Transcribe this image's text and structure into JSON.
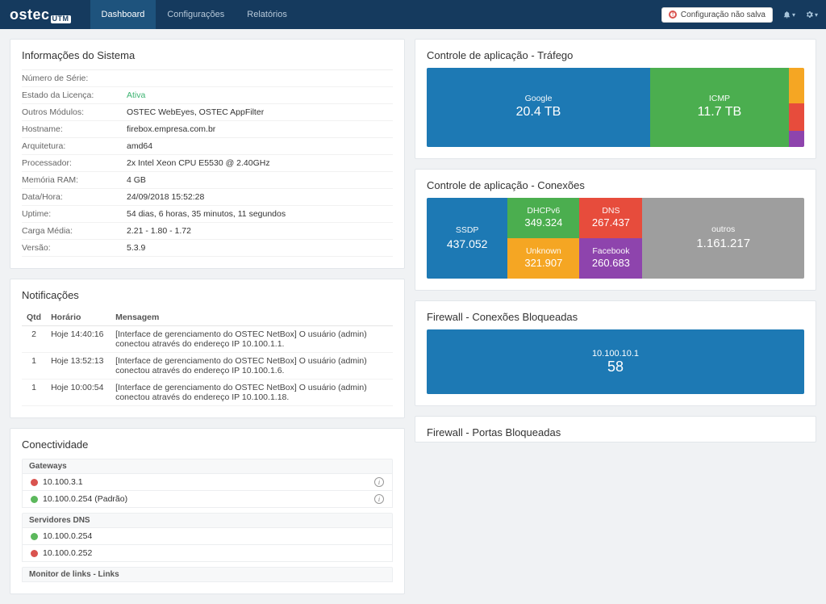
{
  "brand": {
    "name": "ostec",
    "sub": "UTM"
  },
  "nav": {
    "dashboard": "Dashboard",
    "configuracoes": "Configurações",
    "relatorios": "Relatórios",
    "unsaved_badge": "Configuração não salva"
  },
  "sysinfo": {
    "title": "Informações do Sistema",
    "rows": {
      "serial_label": "Número de Série:",
      "serial_value": "",
      "license_label": "Estado da Licença:",
      "license_value": "Ativa",
      "modules_label": "Outros Módulos:",
      "modules_value": "OSTEC WebEyes, OSTEC AppFilter",
      "hostname_label": "Hostname:",
      "hostname_value": "firebox.empresa.com.br",
      "arch_label": "Arquitetura:",
      "arch_value": "amd64",
      "cpu_label": "Processador:",
      "cpu_value": "2x Intel Xeon CPU E5530 @ 2.40GHz",
      "ram_label": "Memória RAM:",
      "ram_value": "4 GB",
      "datetime_label": "Data/Hora:",
      "datetime_value": "24/09/2018 15:52:28",
      "uptime_label": "Uptime:",
      "uptime_value": "54 dias, 6 horas, 35 minutos, 11 segundos",
      "load_label": "Carga Média:",
      "load_value": "2.21 - 1.80 - 1.72",
      "version_label": "Versão:",
      "version_value": "5.3.9"
    }
  },
  "notifications": {
    "title": "Notificações",
    "headers": {
      "qtd": "Qtd",
      "horario": "Horário",
      "mensagem": "Mensagem"
    },
    "rows": [
      {
        "qtd": "2",
        "time": "Hoje 14:40:16",
        "msg": "[Interface de gerenciamento do OSTEC NetBox] O usuário (admin) conectou através do endereço IP 10.100.1.1."
      },
      {
        "qtd": "1",
        "time": "Hoje 13:52:13",
        "msg": "[Interface de gerenciamento do OSTEC NetBox] O usuário (admin) conectou através do endereço IP 10.100.1.6."
      },
      {
        "qtd": "1",
        "time": "Hoje 10:00:54",
        "msg": "[Interface de gerenciamento do OSTEC NetBox] O usuário (admin) conectou através do endereço IP 10.100.1.18."
      }
    ]
  },
  "connectivity": {
    "title": "Conectividade",
    "gateways_label": "Gateways",
    "gateways": [
      {
        "status": "red",
        "ip": "10.100.3.1"
      },
      {
        "status": "green",
        "ip": "10.100.0.254 (Padrão)"
      }
    ],
    "dns_label": "Servidores DNS",
    "dns": [
      {
        "status": "green",
        "ip": "10.100.0.254"
      },
      {
        "status": "red",
        "ip": "10.100.0.252"
      }
    ],
    "links_label": "Monitor de links - Links"
  },
  "appctrl_traffic": {
    "title": "Controle de aplicação - Tráfego"
  },
  "appctrl_conn": {
    "title": "Controle de aplicação - Conexões"
  },
  "fw_blocked_conn": {
    "title": "Firewall - Conexões Bloqueadas",
    "item": {
      "name": "10.100.10.1",
      "value": "58"
    }
  },
  "fw_blocked_ports": {
    "title": "Firewall - Portas Bloqueadas"
  },
  "chart_data": [
    {
      "type": "treemap",
      "title": "Controle de aplicação - Tráfego",
      "unit": "TB",
      "series": [
        {
          "name": "Google",
          "value": 20.4,
          "color": "#1d79b4"
        },
        {
          "name": "ICMP",
          "value": 11.7,
          "color": "#4bae4f"
        },
        {
          "name": "",
          "value": 0.9,
          "color": "#f5a623"
        },
        {
          "name": "",
          "value": 0.6,
          "color": "#e74c3c"
        },
        {
          "name": "",
          "value": 0.3,
          "color": "#8e44ad"
        }
      ]
    },
    {
      "type": "treemap",
      "title": "Controle de aplicação - Conexões",
      "series": [
        {
          "name": "SSDP",
          "value": 437052,
          "display": "437.052",
          "color": "#1d79b4"
        },
        {
          "name": "DHCPv6",
          "value": 349324,
          "display": "349.324",
          "color": "#4bae4f"
        },
        {
          "name": "Unknown",
          "value": 321907,
          "display": "321.907",
          "color": "#f5a623"
        },
        {
          "name": "DNS",
          "value": 267437,
          "display": "267.437",
          "color": "#e74c3c"
        },
        {
          "name": "Facebook",
          "value": 260683,
          "display": "260.683",
          "color": "#8e44ad"
        },
        {
          "name": "outros",
          "value": 1161217,
          "display": "1.161.217",
          "color": "#9e9e9e"
        }
      ]
    },
    {
      "type": "bar",
      "title": "Firewall - Conexões Bloqueadas",
      "categories": [
        "10.100.10.1"
      ],
      "values": [
        58
      ]
    }
  ]
}
